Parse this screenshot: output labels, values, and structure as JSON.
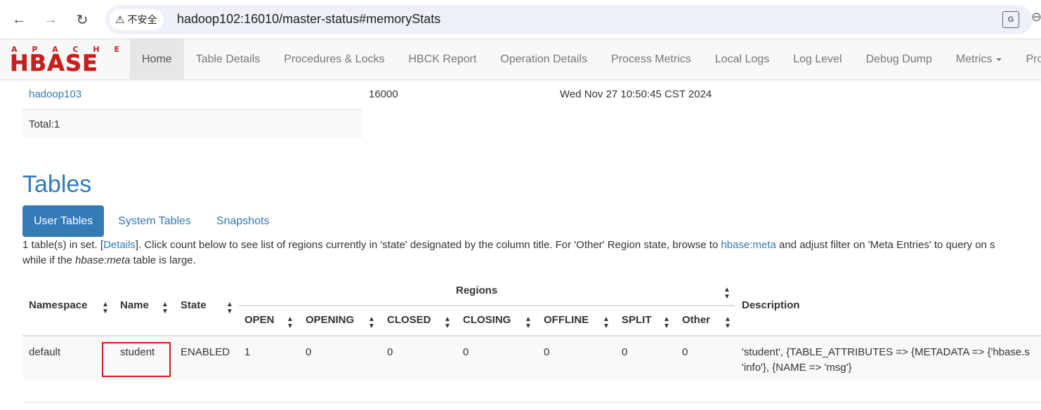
{
  "browser": {
    "security_label": "不安全",
    "url": "hadoop102:16010/master-status#memoryStats"
  },
  "logo": {
    "apache_letters": [
      "A",
      "P",
      "A",
      "C",
      "H",
      "E"
    ],
    "hbase": "HBASE"
  },
  "navbar": {
    "items": [
      {
        "label": "Home",
        "active": true
      },
      {
        "label": "Table Details"
      },
      {
        "label": "Procedures & Locks"
      },
      {
        "label": "HBCK Report"
      },
      {
        "label": "Operation Details"
      },
      {
        "label": "Process Metrics"
      },
      {
        "label": "Local Logs"
      },
      {
        "label": "Log Level"
      },
      {
        "label": "Debug Dump"
      },
      {
        "label": "Metrics"
      },
      {
        "label": "Profi"
      }
    ]
  },
  "masters": {
    "row": {
      "host": "hadoop103",
      "port": "16000",
      "start_time": "Wed Nov 27 10:50:45 CST 2024"
    },
    "total": "Total:1"
  },
  "tables": {
    "heading": "Tables",
    "tabs": [
      "User Tables",
      "System Tables",
      "Snapshots"
    ],
    "description": {
      "p1": "1 table(s) in set. [",
      "details_link": "Details",
      "p2": "]. Click count below to see list of regions currently in 'state' designated by the column title. For 'Other' Region state, browse to ",
      "meta_link": "hbase:meta",
      "p3": " and adjust filter on 'Meta Entries' to query on s",
      "line2_pre": "while if the ",
      "line2_em": "hbase:meta",
      "line2_post": " table is large."
    },
    "headers": {
      "namespace": "Namespace",
      "name": "Name",
      "state": "State",
      "regions": "Regions",
      "open": "OPEN",
      "opening": "OPENING",
      "closed": "CLOSED",
      "closing": "CLOSING",
      "offline": "OFFLINE",
      "split": "SPLIT",
      "other": "Other",
      "description": "Description"
    },
    "row": {
      "namespace": "default",
      "name": "student",
      "state": "ENABLED",
      "open": "1",
      "opening": "0",
      "closed": "0",
      "closing": "0",
      "offline": "0",
      "split": "0",
      "other": "0",
      "desc_line1": "'student', {TABLE_ATTRIBUTES => {METADATA => {'hbase.s",
      "desc_line2": "'info'}, {NAME => 'msg'}"
    }
  },
  "colors": {
    "link": "#337ab7",
    "logo_red": "#c81e1e",
    "highlight_box": "#e0161c"
  }
}
